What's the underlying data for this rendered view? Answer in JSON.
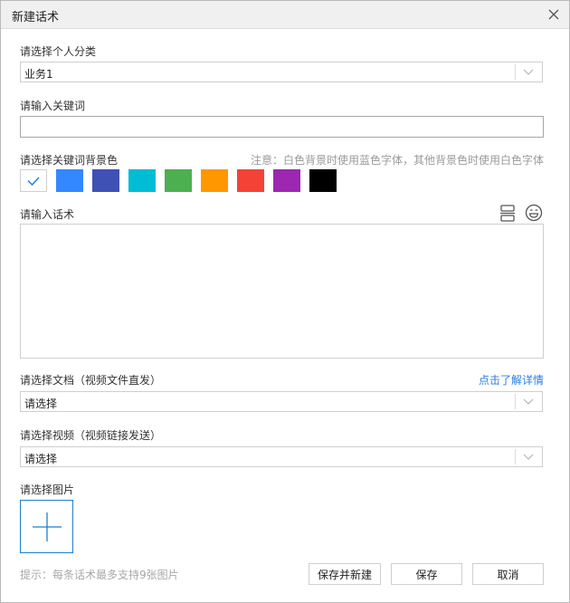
{
  "window": {
    "title": "新建话术"
  },
  "category": {
    "label": "请选择个人分类",
    "value": "业务1"
  },
  "keyword": {
    "label": "请输入关键词",
    "value": ""
  },
  "bg_color": {
    "label": "请选择关键词背景色",
    "note": "注意：白色背景时使用蓝色字体，其他背景色时使用白色字体",
    "colors": [
      "#ffffff",
      "#3388ff",
      "#3f51b5",
      "#00bcd4",
      "#4caf50",
      "#ff9800",
      "#f44336",
      "#9c27b0",
      "#000000"
    ],
    "selected": "#ffffff",
    "check_color": "#2a7de1"
  },
  "script": {
    "label": "请输入话术",
    "value": ""
  },
  "document": {
    "label": "请选择文档（视频文件直发）",
    "link": "点击了解详情",
    "value": "请选择"
  },
  "video": {
    "label": "请选择视频（视频链接发送）",
    "value": "请选择"
  },
  "image": {
    "label": "请选择图片"
  },
  "footer": {
    "hint": "提示：每条话术最多支持9张图片",
    "save_new_label": "保存并新建",
    "save_label": "保存",
    "cancel_label": "取消"
  }
}
